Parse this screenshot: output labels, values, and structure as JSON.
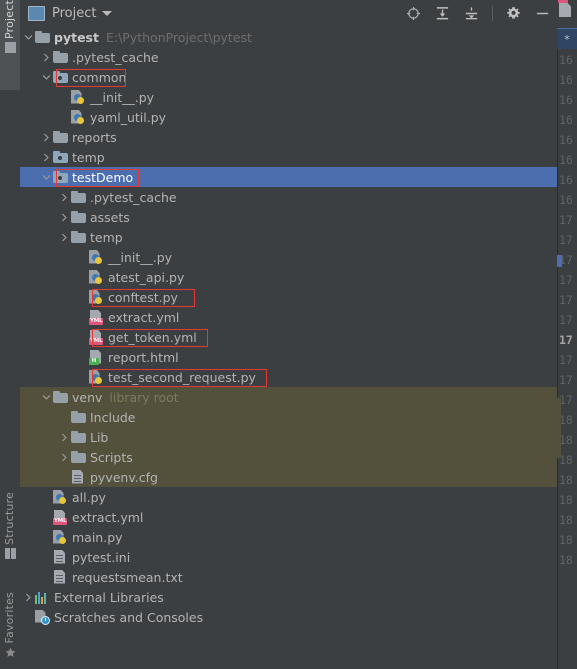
{
  "window": {
    "background": "#3c3f41",
    "selection_color": "#4b6eaf",
    "excluded_color": "#53503c",
    "annotation_color": "#e53935"
  },
  "tool_strip": {
    "tabs": [
      {
        "label": "Project",
        "icon": "project-panel-icon",
        "active": true
      },
      {
        "label": "Structure",
        "icon": "structure-panel-icon",
        "active": false
      },
      {
        "label": "Favorites",
        "icon": "favorites-star-icon",
        "active": false
      }
    ]
  },
  "panel_header": {
    "title": "Project",
    "icon": "project-view-icon",
    "dropdown_icon": "chevron-down-icon",
    "toolbar_buttons": [
      {
        "name": "locate-file-icon",
        "tooltip": "Select Opened File"
      },
      {
        "name": "expand-all-icon",
        "tooltip": "Expand All"
      },
      {
        "name": "collapse-all-icon",
        "tooltip": "Collapse All"
      },
      {
        "name": "gear-icon",
        "tooltip": "Settings"
      },
      {
        "name": "hide-icon",
        "tooltip": "Hide"
      }
    ]
  },
  "tree": {
    "rows": [
      {
        "depth": 0,
        "arrow": "down",
        "icon": "folder",
        "label": "pytest",
        "sublabel": "E:\\PythonProject\\pytest",
        "bold": true
      },
      {
        "depth": 1,
        "arrow": "right",
        "icon": "folder",
        "label": ".pytest_cache"
      },
      {
        "depth": 1,
        "arrow": "down",
        "icon": "folder-source",
        "label": "common",
        "boxed": true
      },
      {
        "depth": 2,
        "arrow": "none",
        "icon": "python",
        "label": "__init__.py"
      },
      {
        "depth": 2,
        "arrow": "none",
        "icon": "python",
        "label": "yaml_util.py"
      },
      {
        "depth": 1,
        "arrow": "right",
        "icon": "folder",
        "label": "reports"
      },
      {
        "depth": 1,
        "arrow": "right",
        "icon": "folder-source",
        "label": "temp"
      },
      {
        "depth": 1,
        "arrow": "down",
        "icon": "folder-source",
        "label": "testDemo",
        "selected": true,
        "boxed": true
      },
      {
        "depth": 2,
        "arrow": "right",
        "icon": "folder",
        "label": ".pytest_cache"
      },
      {
        "depth": 2,
        "arrow": "right",
        "icon": "folder",
        "label": "assets"
      },
      {
        "depth": 2,
        "arrow": "right",
        "icon": "folder",
        "label": "temp"
      },
      {
        "depth": 3,
        "arrow": "none",
        "icon": "python",
        "label": "__init__.py"
      },
      {
        "depth": 3,
        "arrow": "none",
        "icon": "python",
        "label": "atest_api.py"
      },
      {
        "depth": 3,
        "arrow": "none",
        "icon": "python",
        "label": "conftest.py",
        "boxed": true
      },
      {
        "depth": 3,
        "arrow": "none",
        "icon": "yml",
        "label": "extract.yml"
      },
      {
        "depth": 3,
        "arrow": "none",
        "icon": "yml",
        "label": "get_token.yml",
        "boxed": true
      },
      {
        "depth": 3,
        "arrow": "none",
        "icon": "html",
        "label": "report.html"
      },
      {
        "depth": 3,
        "arrow": "none",
        "icon": "python",
        "label": "test_second_request.py",
        "boxed": true
      },
      {
        "depth": 1,
        "arrow": "down",
        "icon": "folder",
        "label": "venv",
        "sublabel": "library root",
        "excluded": true
      },
      {
        "depth": 2,
        "arrow": "none",
        "icon": "folder",
        "label": "Include",
        "excluded": true
      },
      {
        "depth": 2,
        "arrow": "right",
        "icon": "folder",
        "label": "Lib",
        "excluded": true
      },
      {
        "depth": 2,
        "arrow": "right",
        "icon": "folder",
        "label": "Scripts",
        "excluded": true
      },
      {
        "depth": 2,
        "arrow": "none",
        "icon": "cfg",
        "label": "pyvenv.cfg",
        "excluded": true
      },
      {
        "depth": 1,
        "arrow": "none",
        "icon": "python",
        "label": "all.py"
      },
      {
        "depth": 1,
        "arrow": "none",
        "icon": "yml",
        "label": "extract.yml"
      },
      {
        "depth": 1,
        "arrow": "none",
        "icon": "python",
        "label": "main.py"
      },
      {
        "depth": 1,
        "arrow": "none",
        "icon": "cfg",
        "label": "pytest.ini"
      },
      {
        "depth": 1,
        "arrow": "none",
        "icon": "cfg",
        "label": "requestsmean.txt"
      },
      {
        "depth": 0,
        "arrow": "right",
        "icon": "libraries",
        "label": "External Libraries"
      },
      {
        "depth": 0,
        "arrow": "none",
        "icon": "scratches",
        "label": "Scratches and Consoles"
      }
    ]
  },
  "editor_sliver": {
    "tab_icon": "csv-file-icon",
    "active_marker": "*",
    "line_numbers": [
      "16",
      "16",
      "16",
      "16",
      "16",
      "16",
      "16",
      "16",
      "17",
      "17",
      "17",
      "17",
      "17",
      "17",
      "17",
      "17",
      "17",
      "17",
      "18",
      "18",
      "18",
      "18",
      "18",
      "18",
      "18",
      "18"
    ],
    "current_line_index": 14
  }
}
